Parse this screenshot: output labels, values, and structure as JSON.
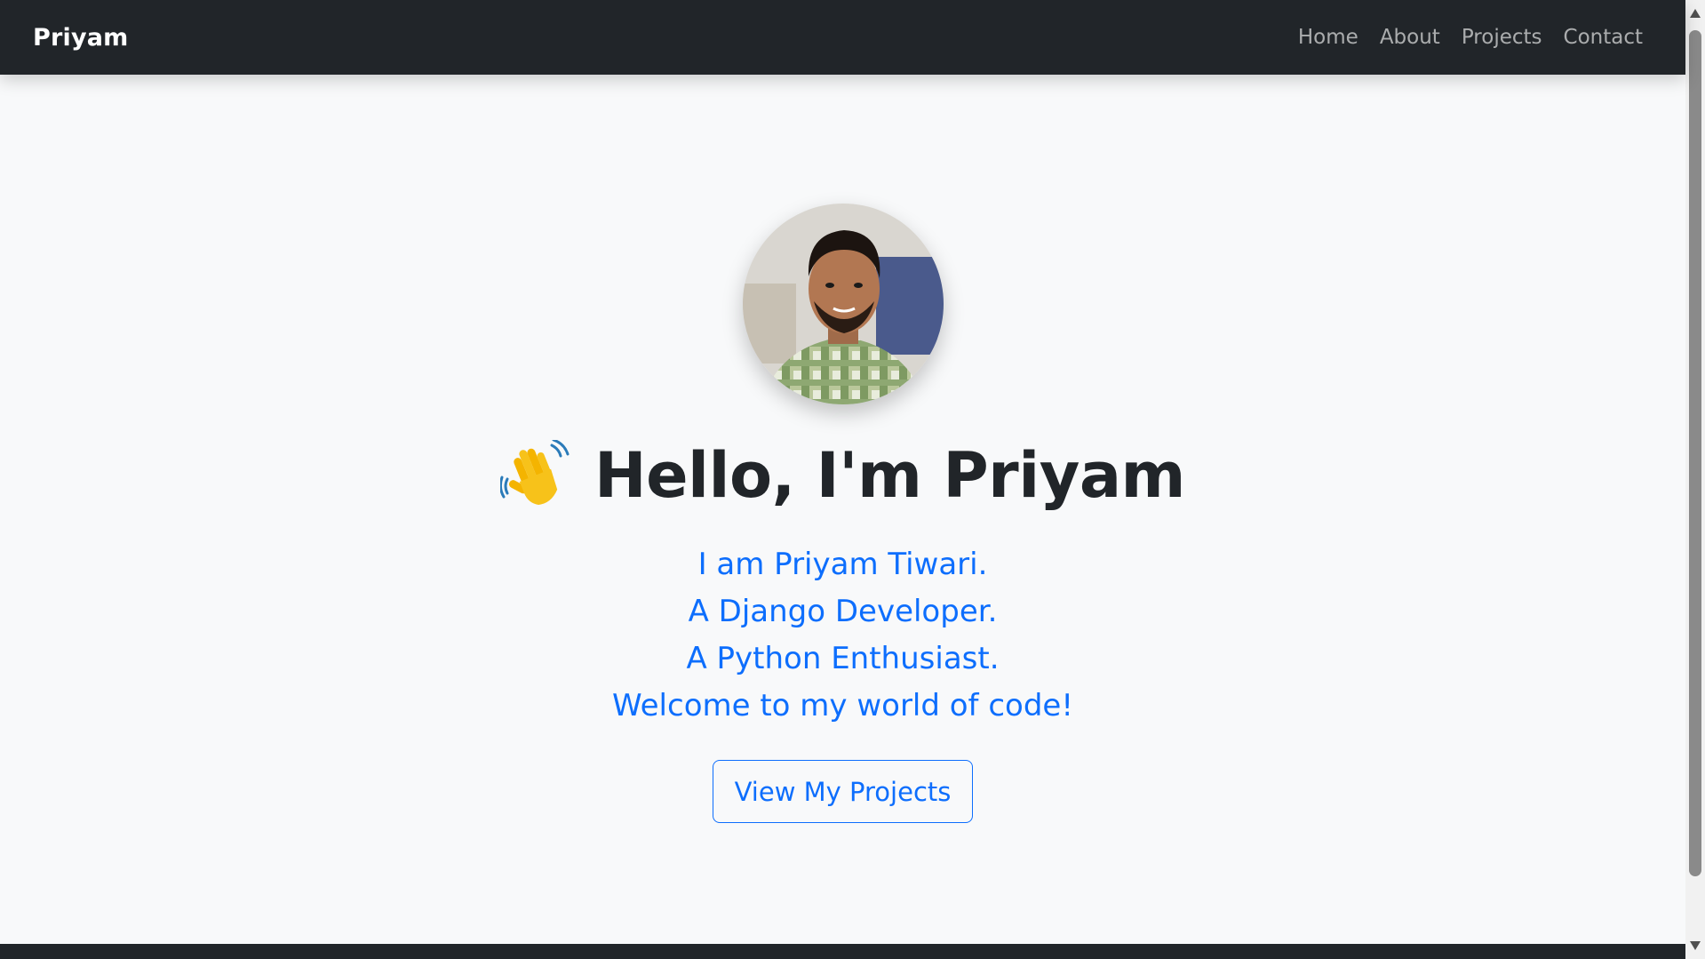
{
  "navbar": {
    "brand": "Priyam",
    "links": [
      "Home",
      "About",
      "Projects",
      "Contact"
    ]
  },
  "hero": {
    "avatar_alt": "profile photo",
    "wave_icon": "waving-hand-icon",
    "headline": "Hello, I'm Priyam",
    "subtitle_lines": [
      "I am Priyam Tiwari.",
      "A Django Developer.",
      "A Python Enthusiast.",
      "Welcome to my world of code!"
    ],
    "cta_label": "View My Projects"
  },
  "colors": {
    "navbar_bg": "#212529",
    "page_bg": "#f8f9fa",
    "accent": "#0d6efd",
    "headline": "#212529"
  }
}
